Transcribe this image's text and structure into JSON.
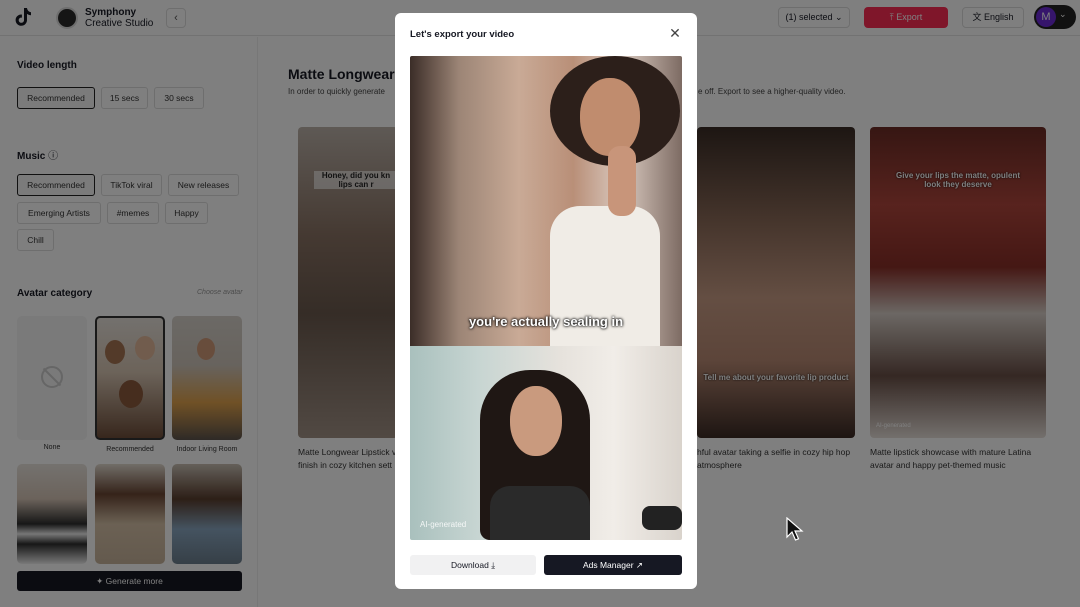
{
  "header": {
    "brand_line1": "Symphony",
    "brand_line2": "Creative Studio",
    "collapse_icon": "‹",
    "selected_label": "(1) selected",
    "export_label": "Export",
    "language_label": "English",
    "avatar_initial": "M"
  },
  "sidebar": {
    "video_length_title": "Video length",
    "video_length_options": [
      "Recommended",
      "15 secs",
      "30 secs"
    ],
    "music_title": "Music",
    "music_options": [
      "Recommended",
      "TikTok viral",
      "New releases",
      "Emerging Artists",
      "#memes",
      "Happy",
      "Chill"
    ],
    "avatar_title": "Avatar category",
    "choose_link": "Choose avatar",
    "avatar_captions": [
      "None",
      "Recommended",
      "Indoor Living Room"
    ],
    "generate_label": "Generate more"
  },
  "main": {
    "title": "Matte Longwear",
    "desc_left": "In order to quickly generate",
    "desc_right": "e off. Export to see a higher-quality video.",
    "cards": [
      {
        "subtitle": "Honey, did you kn lips can r",
        "caption_l1": "Matte Longwear Lipstick v",
        "caption_l2": "finish in cozy kitchen sett"
      },
      {
        "subtitle": "Tell me about your favorite lip product",
        "caption_l1": "hful avatar taking a selfie in cozy hip hop",
        "caption_l2": "atmosphere"
      },
      {
        "subtitle": "Give your lips the matte, opulent look they deserve",
        "caption_l1": "Matte lipstick showcase with mature Latina",
        "caption_l2": "avatar and happy pet-themed music",
        "ai_tag": "AI-generated"
      }
    ]
  },
  "modal": {
    "title": "Let's export your video",
    "close_icon": "✕",
    "video_caption": "you're actually sealing in",
    "ai_tag": "AI-generated",
    "download_label": "Download ⤓",
    "ads_manager_label": "Ads Manager ↗"
  },
  "colors": {
    "accent": "#fe2c55",
    "dark": "#161823",
    "avatar": "#6c2bd9"
  }
}
